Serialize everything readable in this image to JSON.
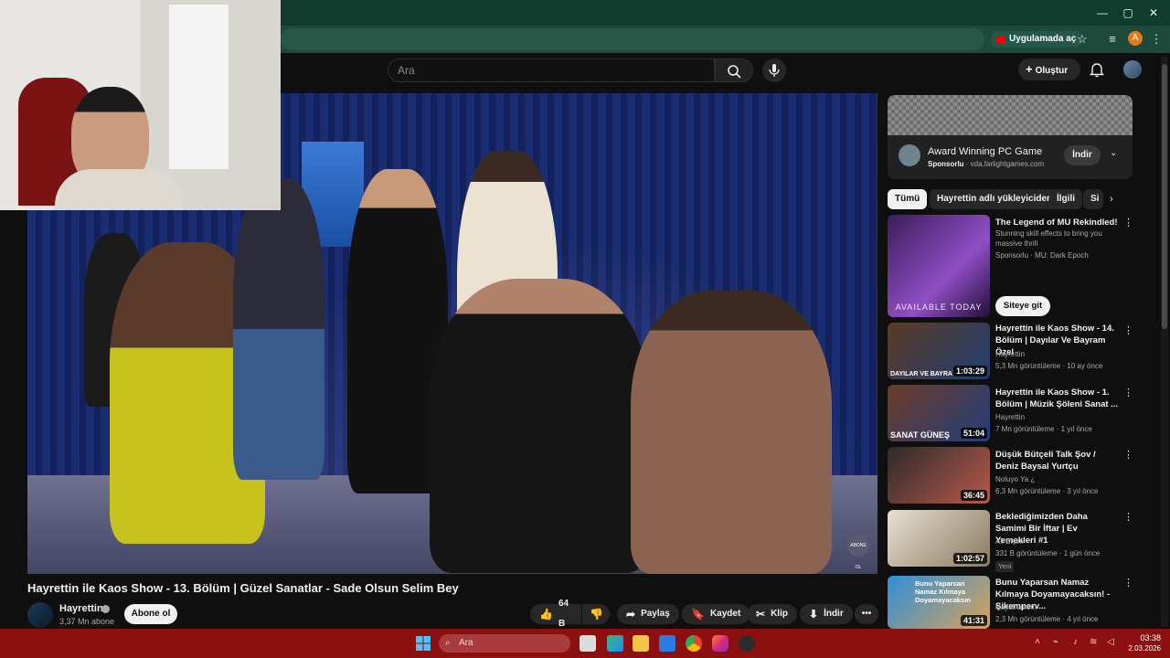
{
  "browser": {
    "open_in_app_label": "Uygulamada aç",
    "profile_initial": "A"
  },
  "header": {
    "search_placeholder": "Ara",
    "create_label": "Oluştur"
  },
  "video": {
    "title": "Hayrettin ile Kaos Show - 13. Bölüm | Güzel Sanatlar - Sade Olsun Selim Bey",
    "channel": "Hayrettin",
    "subscribers": "3,37 Mn abone",
    "subscribe_label": "Abone ol",
    "likes": "64 B",
    "share_label": "Paylaş",
    "save_label": "Kaydet",
    "clip_label": "Klip",
    "download_label": "İndir",
    "more_label": "•••",
    "badge_text": "ABONE OL"
  },
  "ad": {
    "title": "Award Winning PC Game",
    "sponsor_label": "Sponsorlu",
    "sponsor_domain": "vda.farlightgames.com",
    "download_label": "İndir"
  },
  "chips": [
    "Tümü",
    "Hayrettin adlı yükleyiciden",
    "İlgili",
    "Si"
  ],
  "related": [
    {
      "title": "The Legend of MU Rekindled!",
      "desc": "Stunning skill effects to bring you massive thrill",
      "channel": "Sponsorlu · MU: Dark Epoch",
      "cta": "Siteye git",
      "thumb_text": "AVAILABLE TODAY",
      "thumb_colors": [
        "#3a1d5a",
        "#8f4ec4"
      ]
    },
    {
      "title": "Hayrettin ile Kaos Show - 14. Bölüm | Dayılar Ve Bayram Özel",
      "channel": "Hayrettin",
      "meta": "5,3 Mn görüntüleme · 10 ay önce",
      "duration": "1:03:29",
      "thumb_text": "DAYILAR VE BAYRA",
      "thumb_colors": [
        "#5c3b24",
        "#1f3e72"
      ]
    },
    {
      "title": "Hayrettin ile Kaos Show - 1. Bölüm | Müzik Şöleni Sanat ...",
      "channel": "Hayrettin",
      "meta": "7 Mn görüntüleme · 1 yıl önce",
      "duration": "51:04",
      "thumb_text": "SANAT GÜNEŞ",
      "thumb_colors": [
        "#6b3b2a",
        "#233f7a"
      ]
    },
    {
      "title": "Düşük Bütçeli Talk Şov / Deniz Baysal Yurtçu",
      "channel": "Noluyo Ya ¿",
      "meta": "6,3 Mn görüntüleme · 3 yıl önce",
      "duration": "36:45",
      "thumb_colors": [
        "#2e2a2a",
        "#b85a4a"
      ]
    },
    {
      "title": "Beklediğimizden Daha Samimi Bir İftar | Ev Yemekleri #1",
      "channel": "Ali Biçim",
      "meta": "331 B görüntüleme · 1 gün önce",
      "badge": "Yeni",
      "duration": "1:02:57",
      "thumb_colors": [
        "#e8e0d2",
        "#8a7a60"
      ]
    },
    {
      "title": "Bunu Yaparsan Namaz Kılmaya Doyamayacaksın! - Şikemperv...",
      "channel": "Hayalhanem",
      "meta": "2,3 Mn görüntüleme · 4 yıl önce",
      "duration": "41:31",
      "thumb_text": "Bunu Yaparsan Namaz Kılmaya Doyamayacaksın",
      "thumb_colors": [
        "#2f8fd8",
        "#d7a35a"
      ]
    }
  ],
  "taskbar": {
    "search_placeholder": "Ara",
    "time": "03:38",
    "date": "2.03.2026"
  }
}
